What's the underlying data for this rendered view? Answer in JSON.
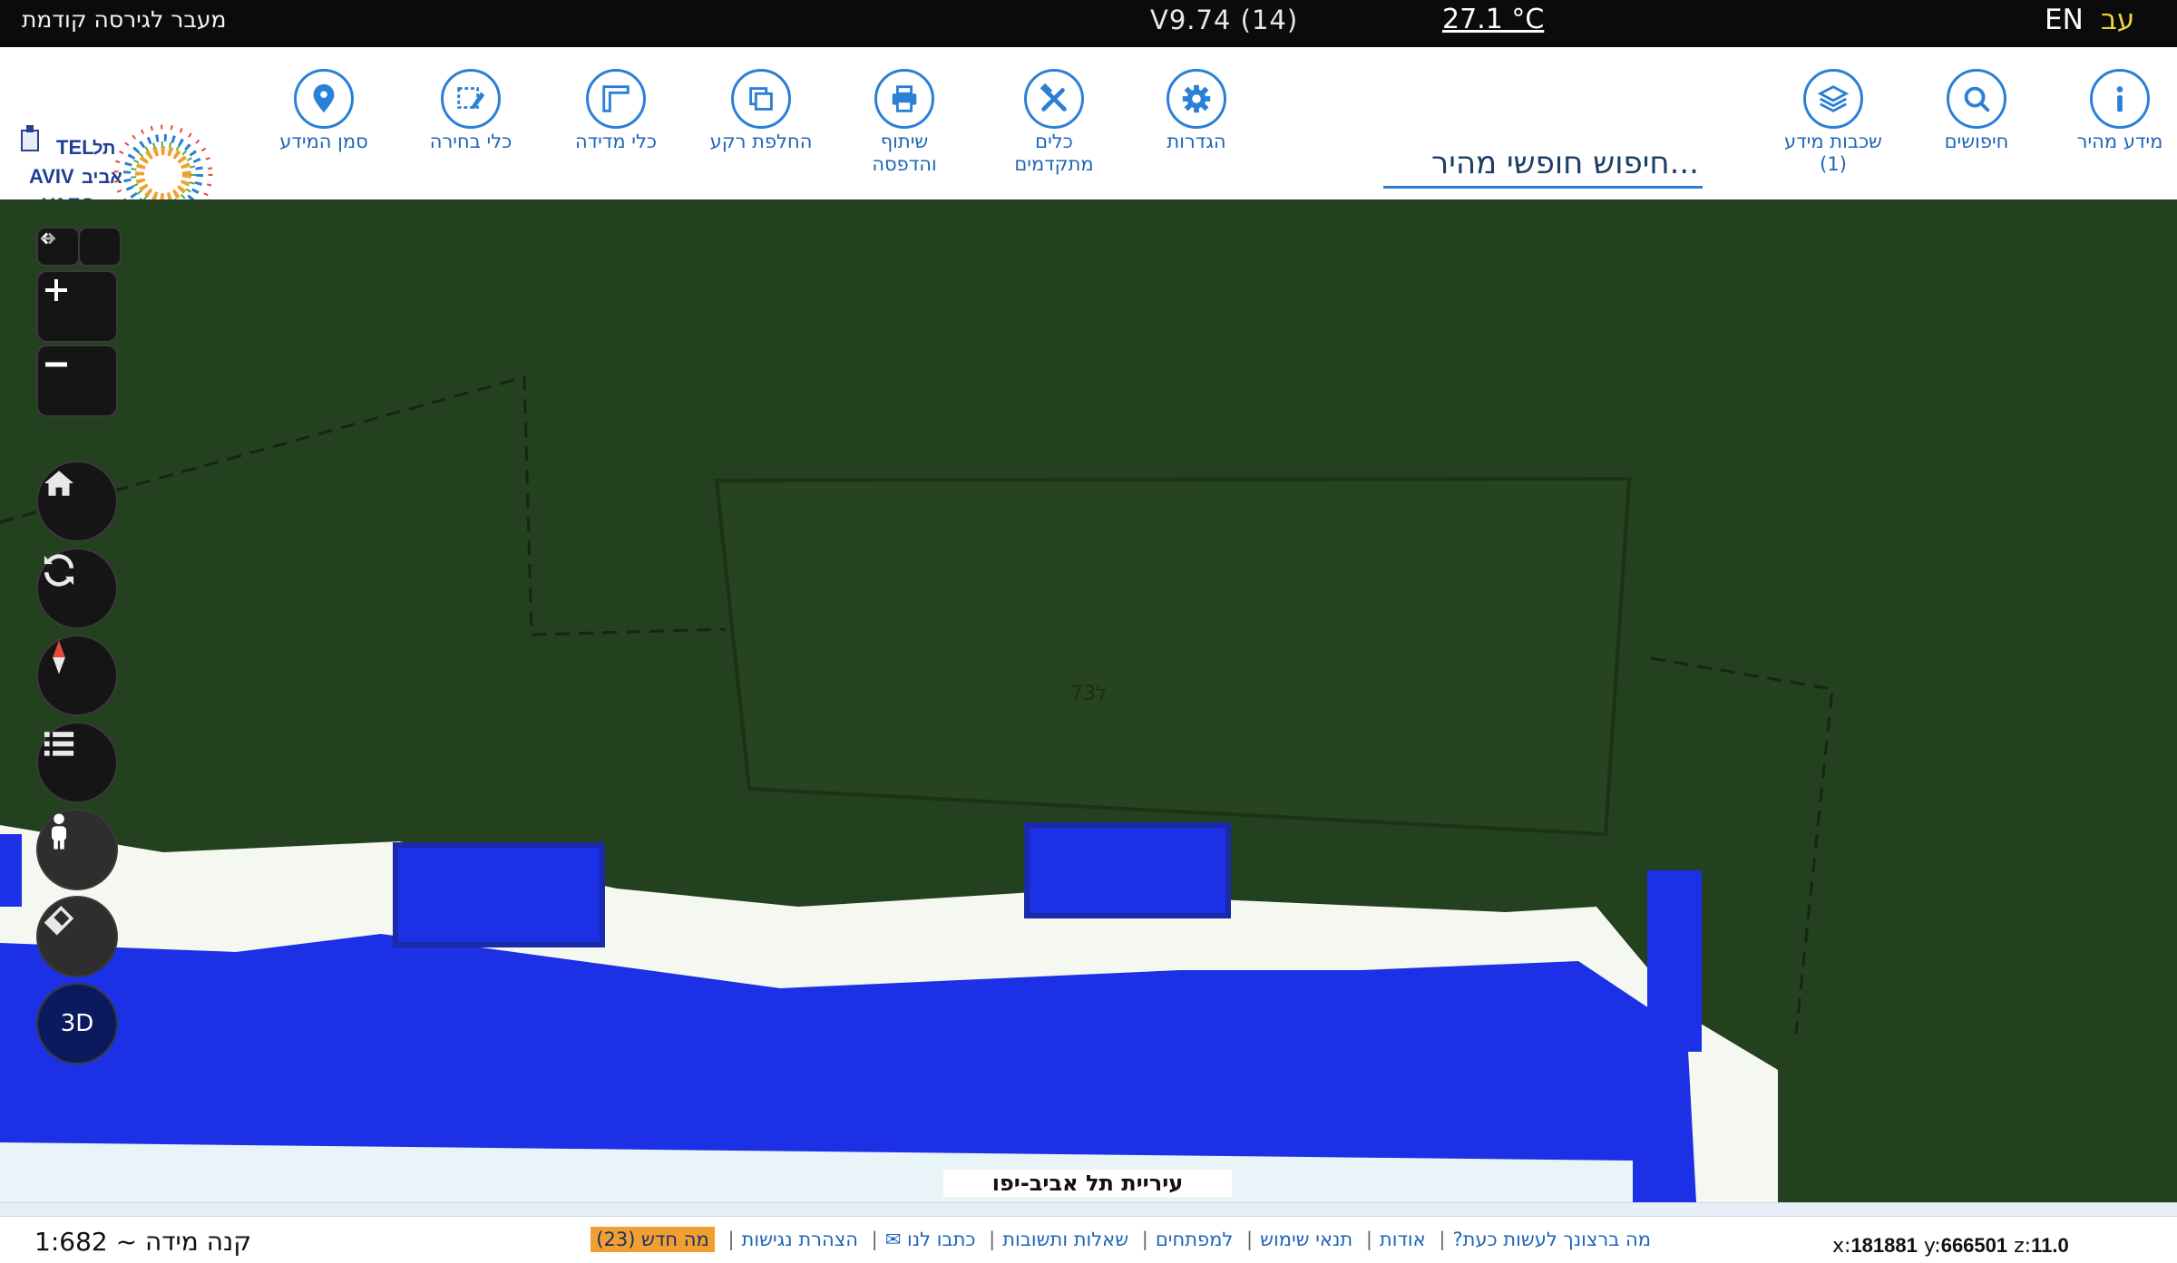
{
  "topbar": {
    "prev_version": "מעבר לגירסה קודמת",
    "version": "V9.74 (14)",
    "temperature": "27.1 °C",
    "lang_en": "EN",
    "lang_he": "עב"
  },
  "toolbar": {
    "items": [
      {
        "label": "מידע מהיר",
        "icon": "info-icon"
      },
      {
        "label": "חיפושים",
        "icon": "search-icon"
      },
      {
        "label": "שכבות מידע (1)",
        "icon": "layers-icon"
      },
      {
        "label": "הגדרות",
        "icon": "gear-icon"
      },
      {
        "label": "כלים מתקדמים",
        "icon": "tools-icon"
      },
      {
        "label": "שיתוף והדפסה",
        "icon": "print-icon"
      },
      {
        "label": "החלפת רקע",
        "icon": "basemap-icon"
      },
      {
        "label": "כלי מדידה",
        "icon": "measure-icon"
      },
      {
        "label": "כלי בחירה",
        "icon": "select-icon"
      },
      {
        "label": "סמן המידע",
        "icon": "marker-icon"
      }
    ],
    "search_placeholder": "חיפוש חופשי מהיר...",
    "logo_text": "TEL AVIV YAFO תל אביב יפו"
  },
  "map": {
    "label": "עיריית תל אביב-יפו",
    "parcel_text": "73ל",
    "controls": [
      "arrows",
      "zoom-in",
      "zoom-out",
      "home",
      "refresh",
      "compass",
      "legend",
      "street-view",
      "eraser",
      "3D"
    ]
  },
  "map_controls": {
    "three_d": "3D"
  },
  "colors": {
    "land": "#23401f",
    "water": "#1c30e6",
    "beach": "#f4f8f0",
    "accent": "#2a7fd6"
  },
  "footer": {
    "scale": "קנה מידה ~ 1:682",
    "links": [
      "מה ברצונך לעשות כעת?",
      "אודות",
      "תנאי שימוש",
      "למפתחים",
      "שאלות ותשובות",
      "כתבו לנו ✉",
      "הצהרת נגישות"
    ],
    "whats_new": "מה חדש (23)",
    "x_label": "x:",
    "x": "181881",
    "y_label": "y:",
    "y": "666501",
    "z_label": "z:",
    "z": "11.0"
  }
}
